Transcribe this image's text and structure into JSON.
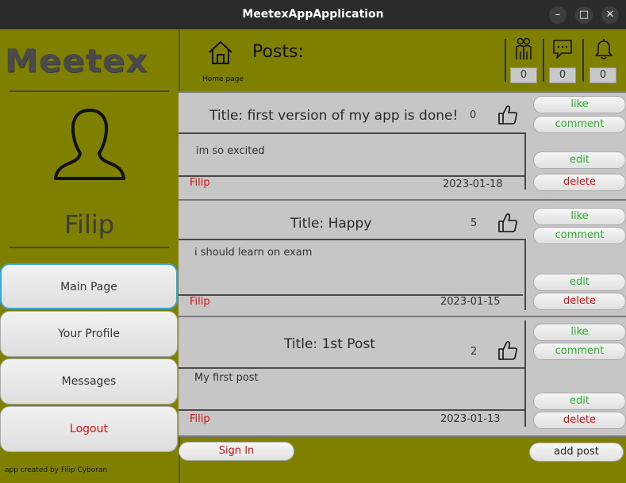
{
  "window": {
    "title": "MeetexAppApplication",
    "controls": {
      "minimize": "–",
      "maximize": "□",
      "close": "✕"
    }
  },
  "sidebar": {
    "logo": "Meetex",
    "username": "Filip",
    "nav": [
      {
        "label": "Main Page",
        "active": true
      },
      {
        "label": "Your Profile"
      },
      {
        "label": "Messages"
      },
      {
        "label": "Logout"
      }
    ],
    "credit": "app created by Filip Cyboran"
  },
  "header": {
    "home_label": "Home page",
    "title": "Posts:",
    "counters": {
      "friends": "0",
      "messages": "0",
      "notifications": "0"
    }
  },
  "posts": [
    {
      "title": "Title: first version of my app is done!",
      "likes": "0",
      "body": "im so excited",
      "author": "Filip",
      "date": "2023-01-18",
      "buttons": {
        "like": "like",
        "comment": "comment",
        "edit": "edit",
        "delete": "delete"
      }
    },
    {
      "title": "Title: Happy",
      "likes": "5",
      "body": "i should learn on exam",
      "author": "Filip",
      "date": "2023-01-15",
      "buttons": {
        "like": "like",
        "comment": "comment",
        "edit": "edit",
        "delete": "delete"
      }
    },
    {
      "title": "Title: 1st Post",
      "likes": "2",
      "body": "My first post",
      "author": "Filip",
      "date": "2023-01-13",
      "buttons": {
        "like": "like",
        "comment": "comment",
        "edit": "edit",
        "delete": "delete"
      }
    }
  ],
  "footer": {
    "sign_in": "Sign In",
    "add_post": "add post"
  },
  "colors": {
    "background": "#7f7f00",
    "accent_green": "#2bb02b",
    "accent_red": "#dd1111",
    "active_border": "#39a7d6"
  }
}
